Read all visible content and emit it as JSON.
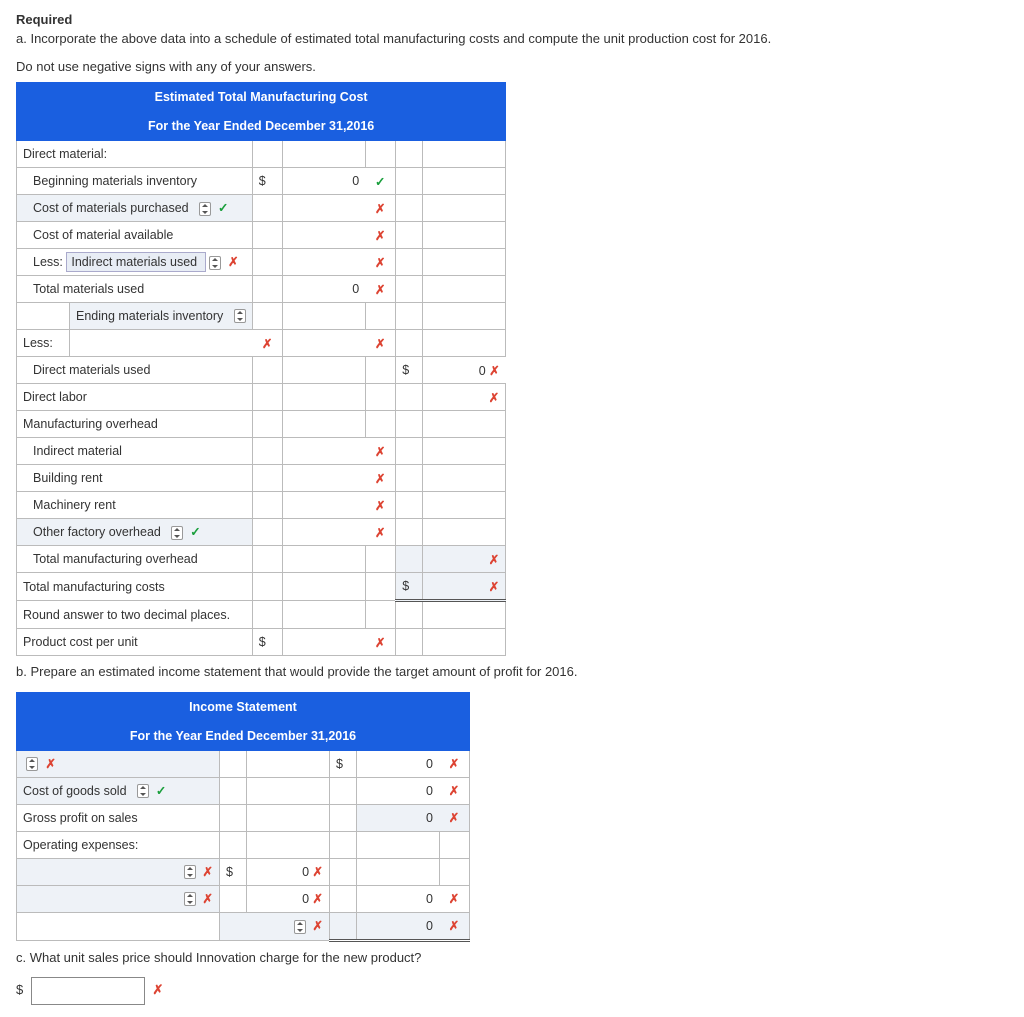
{
  "required_label": "Required",
  "instr_a": "a. Incorporate the above data into a schedule of estimated total manufacturing costs and compute the unit production cost for 2016.",
  "instr_no_neg": "Do not use negative signs with any of your answers.",
  "table1": {
    "title1": "Estimated Total Manufacturing Cost",
    "title2": "For the Year Ended December 31,2016",
    "direct_material": "Direct material:",
    "beg_mat_inv": "Beginning materials inventory",
    "cost_mat_purch": "Cost of materials purchased",
    "cost_mat_avail": "Cost of material available",
    "less": "Less:",
    "indirect_mat_used": "Indirect materials used",
    "total_mat_used": "Total materials used",
    "ending_mat_inv": "Ending materials inventory",
    "direct_mat_used": "Direct materials used",
    "direct_labor": "Direct labor",
    "mfg_overhead": "Manufacturing overhead",
    "indirect_material": "Indirect material",
    "building_rent": "Building rent",
    "machinery_rent": "Machinery rent",
    "other_factory": "Other factory overhead",
    "total_mfg_overhead": "Total manufacturing overhead",
    "total_mfg_costs": "Total manufacturing costs",
    "round_note": "Round answer to two decimal places.",
    "prod_cost_unit": "Product cost per unit",
    "dollar": "$",
    "zero": "0"
  },
  "instr_b": "b. Prepare an estimated income statement that would provide the target amount of profit for 2016.",
  "table2": {
    "title1": "Income Statement",
    "title2": "For the Year Ended December 31,2016",
    "cogs": "Cost of goods sold",
    "gross_profit": "Gross profit on sales",
    "op_exp": "Operating expenses:",
    "dollar": "$",
    "zero": "0"
  },
  "instr_c": "c. What unit sales price should Innovation charge for the new product?",
  "price_dollar": "$",
  "marks": {
    "check": "✓",
    "x": "✗"
  }
}
